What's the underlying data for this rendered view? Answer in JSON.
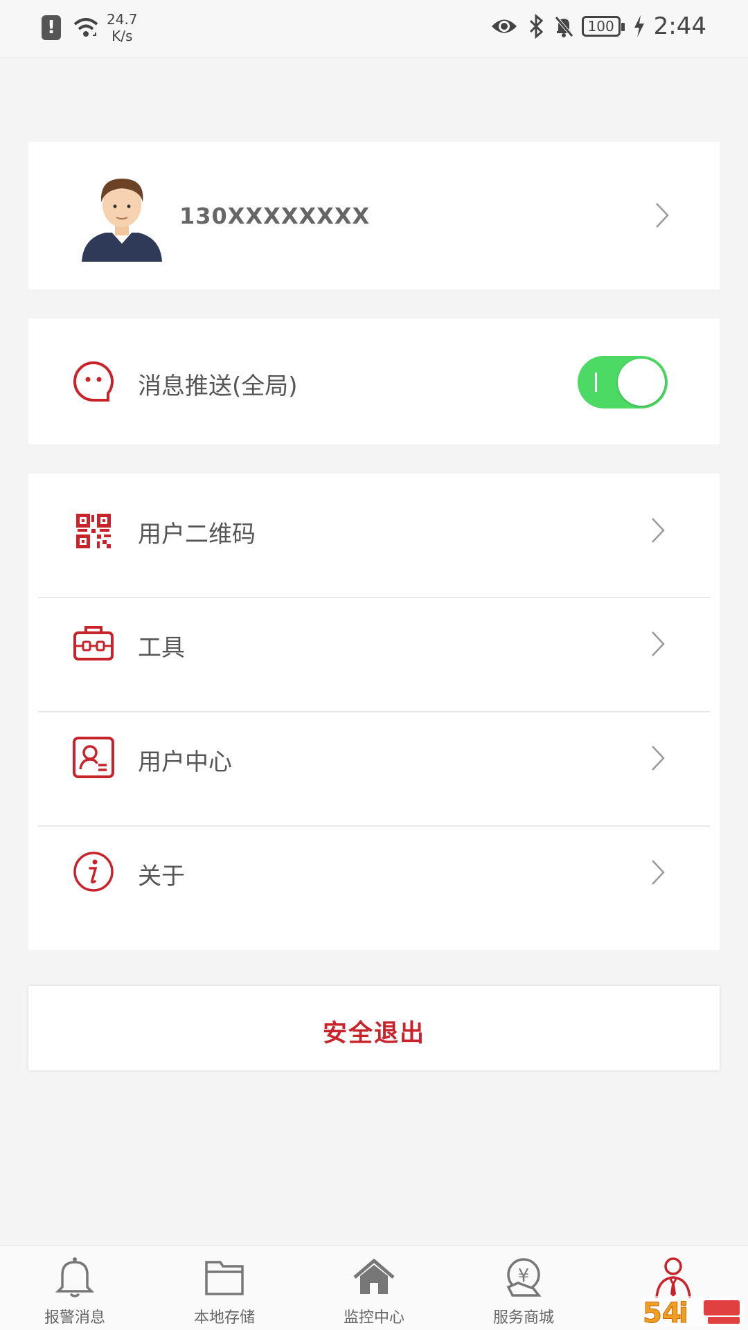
{
  "status_bar": {
    "speed_value": "24.7",
    "speed_unit": "K/s",
    "battery": "100",
    "time": "2:44"
  },
  "profile": {
    "phone": "130XXXXXXXX"
  },
  "push": {
    "label": "消息推送(全局)",
    "enabled": true
  },
  "menu": {
    "items": [
      {
        "label": "用户二维码",
        "icon": "qr-code-icon"
      },
      {
        "label": "工具",
        "icon": "toolbox-icon"
      },
      {
        "label": "用户中心",
        "icon": "user-card-icon"
      },
      {
        "label": "关于",
        "icon": "info-icon"
      }
    ]
  },
  "logout": {
    "label": "安全退出"
  },
  "bottom_nav": {
    "active_index": 4,
    "items": [
      {
        "label": "报警消息",
        "icon": "bell-icon"
      },
      {
        "label": "本地存储",
        "icon": "folder-icon"
      },
      {
        "label": "监控中心",
        "icon": "home-icon"
      },
      {
        "label": "服务商城",
        "icon": "yuan-coin-icon"
      },
      {
        "label": "",
        "icon": "user-profile-icon"
      }
    ]
  },
  "colors": {
    "accent": "#c8232b",
    "toggle_on": "#4cd964",
    "background": "#f4f4f4"
  }
}
